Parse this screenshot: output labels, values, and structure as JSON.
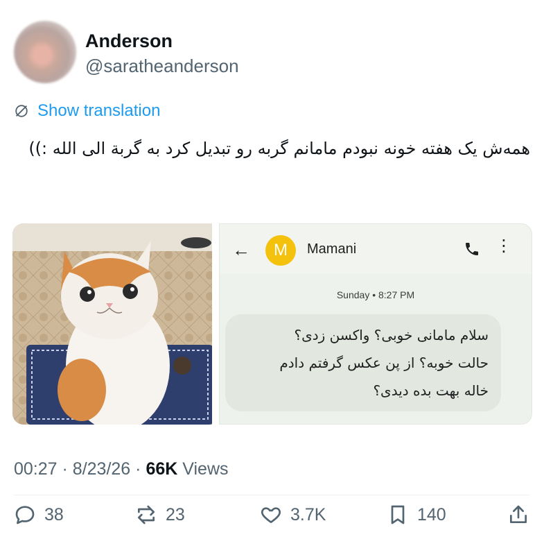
{
  "author": {
    "name": "Anderson",
    "handle": "@saratheanderson"
  },
  "translate_label": "Show translation",
  "tweet_text": "همه‌ش یک هفته خونه نبودم مامانم گربه رو تبدیل کرد به گربة الی الله :))",
  "sms": {
    "contact_initial": "M",
    "contact_name": "Mamani",
    "timestamp": "Sunday • 8:27 PM",
    "message_lines": [
      "سلام مامانی خوبی؟ واکسن زدی؟",
      "حالت خوبه؟  از پن عکس گرفتم دادم",
      "خاله بهت بده دیدی؟"
    ]
  },
  "meta": {
    "time": "00:27",
    "date": "8/23/26",
    "views_count": "66K",
    "views_label": "Views",
    "sep": "·"
  },
  "actions": {
    "replies": "38",
    "reposts": "23",
    "likes": "3.7K",
    "bookmarks": "140"
  },
  "colors": {
    "link": "#1d9bf0",
    "muted": "#536471",
    "text": "#0f1419",
    "sms_avatar": "#f4c20d"
  },
  "icons": [
    "translate-icon",
    "back-arrow-icon",
    "phone-icon",
    "more-vertical-icon",
    "reply-icon",
    "repost-icon",
    "like-icon",
    "bookmark-icon",
    "share-icon"
  ]
}
